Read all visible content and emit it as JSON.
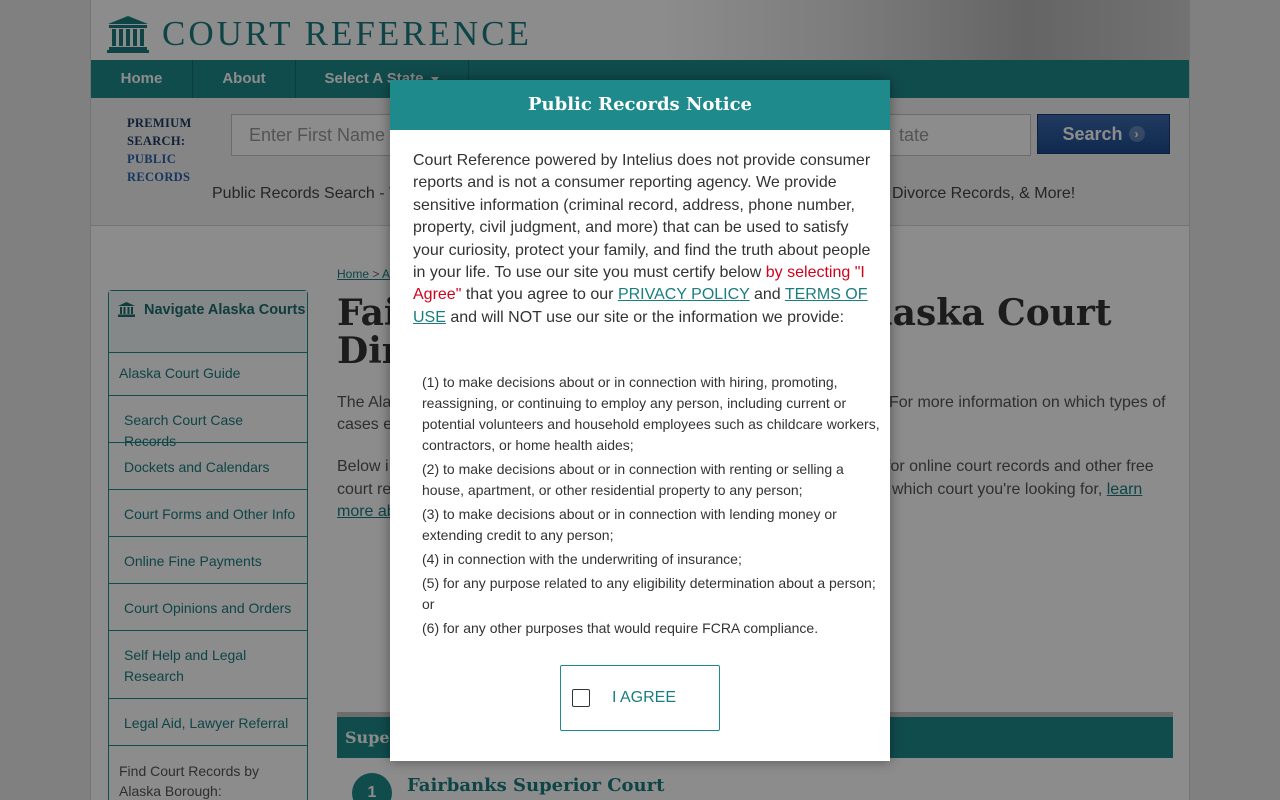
{
  "site": {
    "logo_text": "COURT REFERENCE",
    "nav": [
      {
        "label": "Home"
      },
      {
        "label": "About"
      },
      {
        "label": "Select A State"
      }
    ]
  },
  "search": {
    "premium_label": "PREMIUM SEARCH:",
    "premium_sub": "PUBLIC RECORDS",
    "first_name_placeholder": "Enter First Name",
    "state_placeholder": "tate",
    "button_label": "Search",
    "tagline_left": "Public Records Search - Y",
    "tagline_right": "Divorce Records, & More!"
  },
  "sidebar": {
    "heading": "Navigate Alaska Courts",
    "items": [
      {
        "label": "Alaska Court Guide"
      },
      {
        "label": "Search Court Case Records"
      },
      {
        "label": "Dockets and Calendars"
      },
      {
        "label": "Court Forms and Other Info"
      },
      {
        "label": "Online Fine Payments"
      },
      {
        "label": "Court Opinions and Orders"
      },
      {
        "label": "Self Help and Legal Research"
      },
      {
        "label": "Legal Aid, Lawyer Referral"
      }
    ],
    "footer_text": "Find Court Records by Alaska Borough:"
  },
  "main": {
    "breadcrumb_home": "Home",
    "breadcrumb_sep": " > ",
    "breadcrumb_next": "A",
    "title_left_1": "Fai",
    "title_left_2": "Dir",
    "title_right": "laska Court",
    "para1_left": "The Ala",
    "para1_left2": "cases e",
    "para1_right": "For more information on which types of",
    "para2_left": "Below i",
    "para2_left2": "court re",
    "para2_left3": "more ab",
    "para2_right": "for online court records and other free",
    "para2_right2": "which court you're looking for,",
    "para2_link": "learn",
    "section_bar": "Super",
    "court_number": "1",
    "court_name": "Fairbanks Superior Court"
  },
  "modal": {
    "title": "Public Records Notice",
    "body_1": "Court Reference powered by Intelius does not provide consumer reports and is not a consumer reporting agency. We provide sensitive information (criminal record, address, phone number, property, civil judgment, and more) that can be used to satisfy your curiosity, protect your family, and find the truth about people in your life. To use our site you must certify below",
    "body_red": "by selecting \"I Agree\"",
    "body_2": "that you agree to our",
    "privacy_link": "PRIVACY POLICY",
    "body_and": "and",
    "terms_link": "TERMS OF USE",
    "body_3": "and will NOT use our site or the information we provide:",
    "items": [
      {
        "text": "(1) to make decisions about or in connection with hiring, promoting, reassigning, or continuing to employ any person, including current or potential volunteers and household employees such as childcare workers, contractors, or home health aides;"
      },
      {
        "text": "(2) to make decisions about or in connection with renting or selling a house, apartment, or other residential property to any person;"
      },
      {
        "text": "(3) to make decisions about or in connection with lending money or extending credit to any person;"
      },
      {
        "text": "(4) in connection with the underwriting of insurance;"
      },
      {
        "text": "(5) for any purpose related to any eligibility determination about a person; or"
      },
      {
        "text": "(6) for any other purposes that would require FCRA compliance."
      }
    ],
    "agree_label": "I AGREE",
    "agree_checked": false
  },
  "colors": {
    "teal": "#1f8a8c",
    "link": "#1a7d80",
    "search_button": "#2a5aa0",
    "notice_red": "#d0021b"
  },
  "icons": {
    "logo": "courthouse-icon",
    "sidebar_head": "courthouse-icon",
    "dropdown": "caret-down-icon",
    "search_button": "chevron-right-icon",
    "agree": "checkbox-icon"
  }
}
